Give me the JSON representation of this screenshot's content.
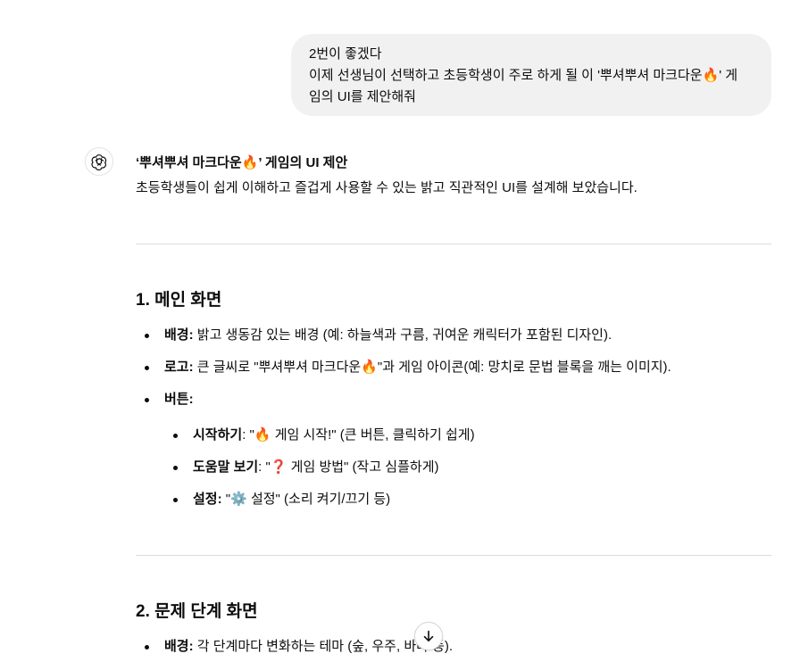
{
  "user_message": {
    "line1": "2번이 좋겠다",
    "line2": "이제 선생님이 선택하고 초등학생이 주로 하게 될 이 '뿌셔뿌셔 마크다운🔥' 게",
    "line3": "임의 UI를 제안해줘"
  },
  "assistant": {
    "avatar_icon": "openai-logo-icon",
    "title": "‘뿌셔뿌셔 마크다운🔥’ 게임의 UI 제안",
    "intro": "초등학생들이 쉽게 이해하고 즐겁게 사용할 수 있는 밝고 직관적인 UI를 설계해 보았습니다.",
    "section1": {
      "title": "1. 메인 화면",
      "items": [
        {
          "label": "배경:",
          "text": " 밝고 생동감 있는 배경 (예: 하늘색과 구름, 귀여운 캐릭터가 포함된 디자인)."
        },
        {
          "label": "로고:",
          "text": " 큰 글씨로 \"뿌셔뿌셔 마크다운🔥\"과 게임 아이콘(예: 망치로 문법 블록을 깨는 이미지)."
        },
        {
          "label": "버튼:",
          "text": ""
        }
      ],
      "sub_items": [
        {
          "label": "시작하기",
          "text": ": \"🔥 게임 시작!\" (큰 버튼, 클릭하기 쉽게)"
        },
        {
          "label": "도움말 보기",
          "text": ": \"❓ 게임 방법\" (작고 심플하게)"
        },
        {
          "label": "설정:",
          "text": " \"⚙️ 설정\" (소리 켜기/끄기 등)"
        }
      ]
    },
    "section2": {
      "title": "2. 문제 단계 화면",
      "items": [
        {
          "label": "배경:",
          "text": " 각 단계마다 변화하는 테마 (숲, 우주, 바다 등)."
        }
      ]
    }
  },
  "scroll_button_icon": "arrow-down-icon"
}
